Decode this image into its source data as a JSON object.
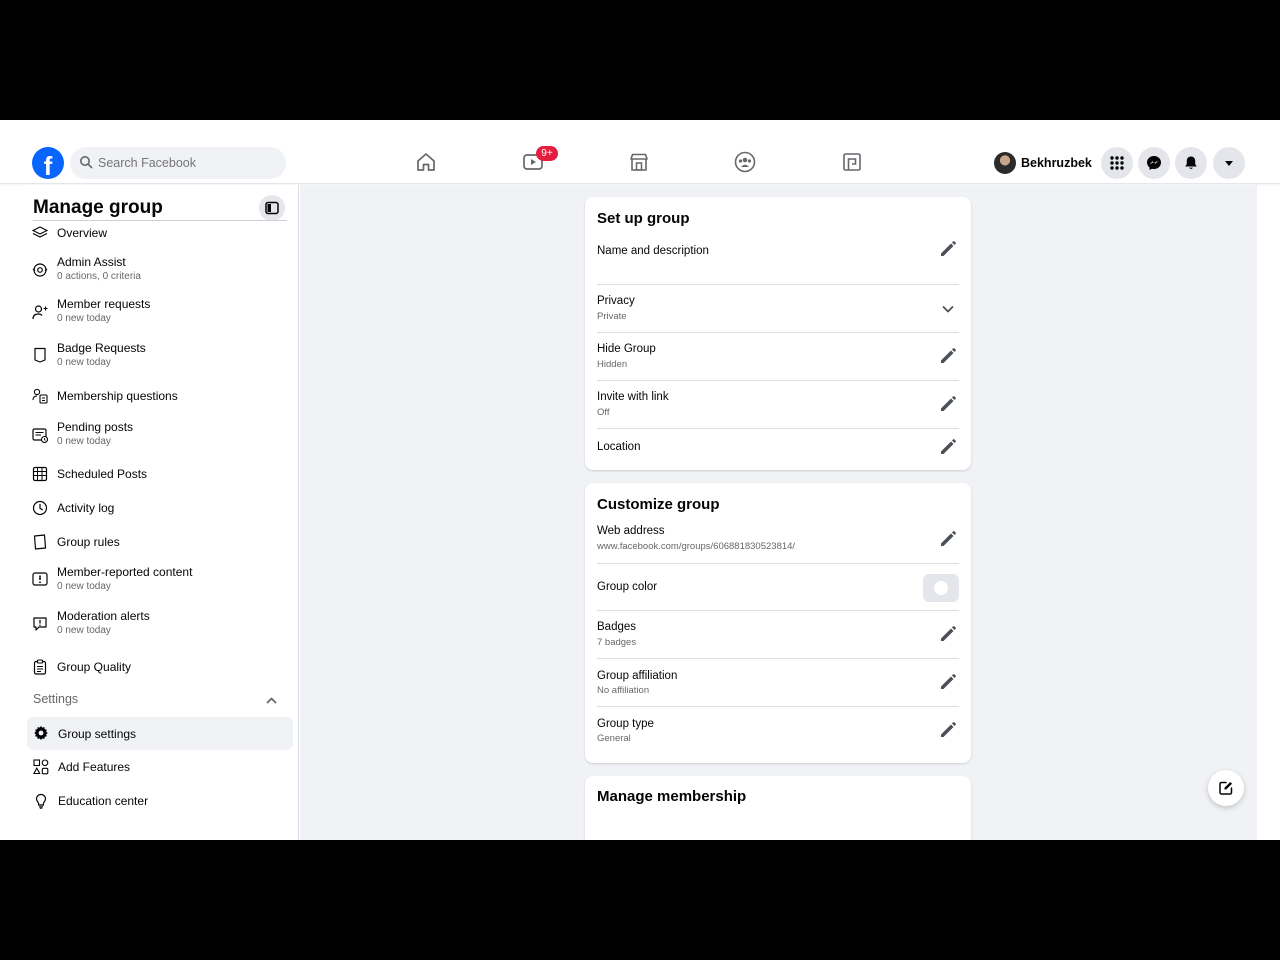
{
  "search": {
    "placeholder": "Search Facebook"
  },
  "nav": {
    "watch_badge": "9+",
    "user_name": "Bekhruzbek"
  },
  "sidebar": {
    "title": "Manage group",
    "items": [
      {
        "label": "Overview",
        "sub": "",
        "icon": "layers-icon"
      },
      {
        "label": "Admin Assist",
        "sub": "0 actions, 0 criteria",
        "icon": "admin-assist-icon"
      },
      {
        "label": "Member requests",
        "sub": "0 new today",
        "icon": "member-requests-icon"
      },
      {
        "label": "Badge Requests",
        "sub": "0 new today",
        "icon": "badge-icon"
      },
      {
        "label": "Membership questions",
        "sub": "",
        "icon": "membership-questions-icon"
      },
      {
        "label": "Pending posts",
        "sub": "0 new today",
        "icon": "pending-posts-icon"
      },
      {
        "label": "Scheduled Posts",
        "sub": "",
        "icon": "calendar-icon"
      },
      {
        "label": "Activity log",
        "sub": "",
        "icon": "clock-icon"
      },
      {
        "label": "Group rules",
        "sub": "",
        "icon": "rules-icon"
      },
      {
        "label": "Member-reported content",
        "sub": "0 new today",
        "icon": "report-icon"
      },
      {
        "label": "Moderation alerts",
        "sub": "0 new today",
        "icon": "alert-icon"
      },
      {
        "label": "Group Quality",
        "sub": "",
        "icon": "clipboard-icon"
      }
    ],
    "settings_header": "Settings",
    "settings_items": [
      {
        "label": "Group settings",
        "icon": "gear-icon",
        "active": true
      },
      {
        "label": "Add Features",
        "icon": "shapes-icon",
        "active": false
      },
      {
        "label": "Education center",
        "icon": "lightbulb-icon",
        "active": false
      }
    ]
  },
  "setup": {
    "title": "Set up group",
    "rows": [
      {
        "label": "Name and description",
        "sub": "",
        "action": "edit"
      },
      {
        "label": "Privacy",
        "sub": "Private",
        "action": "chevron"
      },
      {
        "label": "Hide Group",
        "sub": "Hidden",
        "action": "edit"
      },
      {
        "label": "Invite with link",
        "sub": "Off",
        "action": "edit"
      },
      {
        "label": "Location",
        "sub": "",
        "action": "edit"
      }
    ]
  },
  "customize": {
    "title": "Customize group",
    "rows": [
      {
        "label": "Web address",
        "sub": "www.facebook.com/groups/606881830523814/",
        "action": "edit"
      },
      {
        "label": "Group color",
        "sub": "",
        "action": "swatch"
      },
      {
        "label": "Badges",
        "sub": "7 badges",
        "action": "edit"
      },
      {
        "label": "Group affiliation",
        "sub": "No affiliation",
        "action": "edit"
      },
      {
        "label": "Group type",
        "sub": "General",
        "action": "edit"
      }
    ]
  },
  "membership": {
    "title": "Manage membership"
  },
  "colors": {
    "brand": "#0866ff",
    "badge": "#e41e3f",
    "bg": "#f0f2f5"
  }
}
